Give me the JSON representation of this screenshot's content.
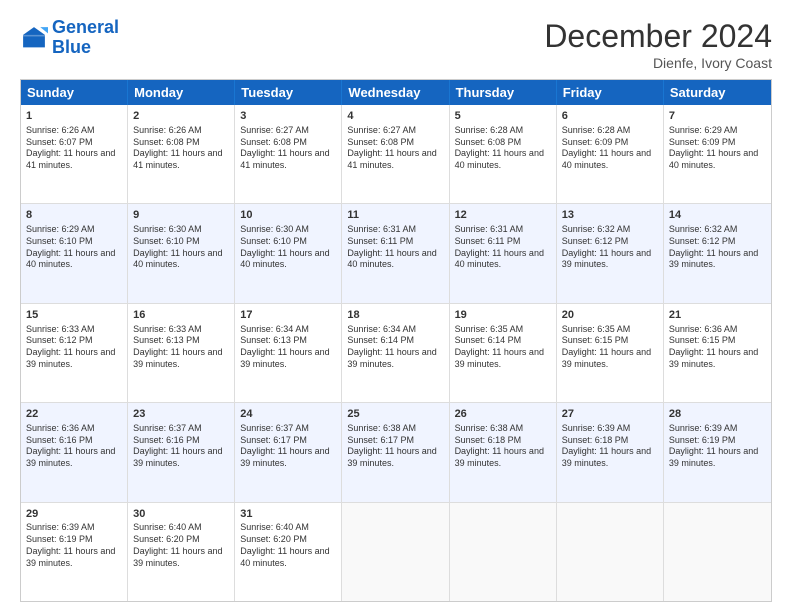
{
  "logo": {
    "line1": "General",
    "line2": "Blue"
  },
  "title": "December 2024",
  "subtitle": "Dienfe, Ivory Coast",
  "days": [
    "Sunday",
    "Monday",
    "Tuesday",
    "Wednesday",
    "Thursday",
    "Friday",
    "Saturday"
  ],
  "weeks": [
    [
      {
        "day": "1",
        "sunrise": "Sunrise: 6:26 AM",
        "sunset": "Sunset: 6:07 PM",
        "daylight": "Daylight: 11 hours and 41 minutes."
      },
      {
        "day": "2",
        "sunrise": "Sunrise: 6:26 AM",
        "sunset": "Sunset: 6:08 PM",
        "daylight": "Daylight: 11 hours and 41 minutes."
      },
      {
        "day": "3",
        "sunrise": "Sunrise: 6:27 AM",
        "sunset": "Sunset: 6:08 PM",
        "daylight": "Daylight: 11 hours and 41 minutes."
      },
      {
        "day": "4",
        "sunrise": "Sunrise: 6:27 AM",
        "sunset": "Sunset: 6:08 PM",
        "daylight": "Daylight: 11 hours and 41 minutes."
      },
      {
        "day": "5",
        "sunrise": "Sunrise: 6:28 AM",
        "sunset": "Sunset: 6:08 PM",
        "daylight": "Daylight: 11 hours and 40 minutes."
      },
      {
        "day": "6",
        "sunrise": "Sunrise: 6:28 AM",
        "sunset": "Sunset: 6:09 PM",
        "daylight": "Daylight: 11 hours and 40 minutes."
      },
      {
        "day": "7",
        "sunrise": "Sunrise: 6:29 AM",
        "sunset": "Sunset: 6:09 PM",
        "daylight": "Daylight: 11 hours and 40 minutes."
      }
    ],
    [
      {
        "day": "8",
        "sunrise": "Sunrise: 6:29 AM",
        "sunset": "Sunset: 6:10 PM",
        "daylight": "Daylight: 11 hours and 40 minutes."
      },
      {
        "day": "9",
        "sunrise": "Sunrise: 6:30 AM",
        "sunset": "Sunset: 6:10 PM",
        "daylight": "Daylight: 11 hours and 40 minutes."
      },
      {
        "day": "10",
        "sunrise": "Sunrise: 6:30 AM",
        "sunset": "Sunset: 6:10 PM",
        "daylight": "Daylight: 11 hours and 40 minutes."
      },
      {
        "day": "11",
        "sunrise": "Sunrise: 6:31 AM",
        "sunset": "Sunset: 6:11 PM",
        "daylight": "Daylight: 11 hours and 40 minutes."
      },
      {
        "day": "12",
        "sunrise": "Sunrise: 6:31 AM",
        "sunset": "Sunset: 6:11 PM",
        "daylight": "Daylight: 11 hours and 40 minutes."
      },
      {
        "day": "13",
        "sunrise": "Sunrise: 6:32 AM",
        "sunset": "Sunset: 6:12 PM",
        "daylight": "Daylight: 11 hours and 39 minutes."
      },
      {
        "day": "14",
        "sunrise": "Sunrise: 6:32 AM",
        "sunset": "Sunset: 6:12 PM",
        "daylight": "Daylight: 11 hours and 39 minutes."
      }
    ],
    [
      {
        "day": "15",
        "sunrise": "Sunrise: 6:33 AM",
        "sunset": "Sunset: 6:12 PM",
        "daylight": "Daylight: 11 hours and 39 minutes."
      },
      {
        "day": "16",
        "sunrise": "Sunrise: 6:33 AM",
        "sunset": "Sunset: 6:13 PM",
        "daylight": "Daylight: 11 hours and 39 minutes."
      },
      {
        "day": "17",
        "sunrise": "Sunrise: 6:34 AM",
        "sunset": "Sunset: 6:13 PM",
        "daylight": "Daylight: 11 hours and 39 minutes."
      },
      {
        "day": "18",
        "sunrise": "Sunrise: 6:34 AM",
        "sunset": "Sunset: 6:14 PM",
        "daylight": "Daylight: 11 hours and 39 minutes."
      },
      {
        "day": "19",
        "sunrise": "Sunrise: 6:35 AM",
        "sunset": "Sunset: 6:14 PM",
        "daylight": "Daylight: 11 hours and 39 minutes."
      },
      {
        "day": "20",
        "sunrise": "Sunrise: 6:35 AM",
        "sunset": "Sunset: 6:15 PM",
        "daylight": "Daylight: 11 hours and 39 minutes."
      },
      {
        "day": "21",
        "sunrise": "Sunrise: 6:36 AM",
        "sunset": "Sunset: 6:15 PM",
        "daylight": "Daylight: 11 hours and 39 minutes."
      }
    ],
    [
      {
        "day": "22",
        "sunrise": "Sunrise: 6:36 AM",
        "sunset": "Sunset: 6:16 PM",
        "daylight": "Daylight: 11 hours and 39 minutes."
      },
      {
        "day": "23",
        "sunrise": "Sunrise: 6:37 AM",
        "sunset": "Sunset: 6:16 PM",
        "daylight": "Daylight: 11 hours and 39 minutes."
      },
      {
        "day": "24",
        "sunrise": "Sunrise: 6:37 AM",
        "sunset": "Sunset: 6:17 PM",
        "daylight": "Daylight: 11 hours and 39 minutes."
      },
      {
        "day": "25",
        "sunrise": "Sunrise: 6:38 AM",
        "sunset": "Sunset: 6:17 PM",
        "daylight": "Daylight: 11 hours and 39 minutes."
      },
      {
        "day": "26",
        "sunrise": "Sunrise: 6:38 AM",
        "sunset": "Sunset: 6:18 PM",
        "daylight": "Daylight: 11 hours and 39 minutes."
      },
      {
        "day": "27",
        "sunrise": "Sunrise: 6:39 AM",
        "sunset": "Sunset: 6:18 PM",
        "daylight": "Daylight: 11 hours and 39 minutes."
      },
      {
        "day": "28",
        "sunrise": "Sunrise: 6:39 AM",
        "sunset": "Sunset: 6:19 PM",
        "daylight": "Daylight: 11 hours and 39 minutes."
      }
    ],
    [
      {
        "day": "29",
        "sunrise": "Sunrise: 6:39 AM",
        "sunset": "Sunset: 6:19 PM",
        "daylight": "Daylight: 11 hours and 39 minutes."
      },
      {
        "day": "30",
        "sunrise": "Sunrise: 6:40 AM",
        "sunset": "Sunset: 6:20 PM",
        "daylight": "Daylight: 11 hours and 39 minutes."
      },
      {
        "day": "31",
        "sunrise": "Sunrise: 6:40 AM",
        "sunset": "Sunset: 6:20 PM",
        "daylight": "Daylight: 11 hours and 40 minutes."
      },
      null,
      null,
      null,
      null
    ]
  ]
}
